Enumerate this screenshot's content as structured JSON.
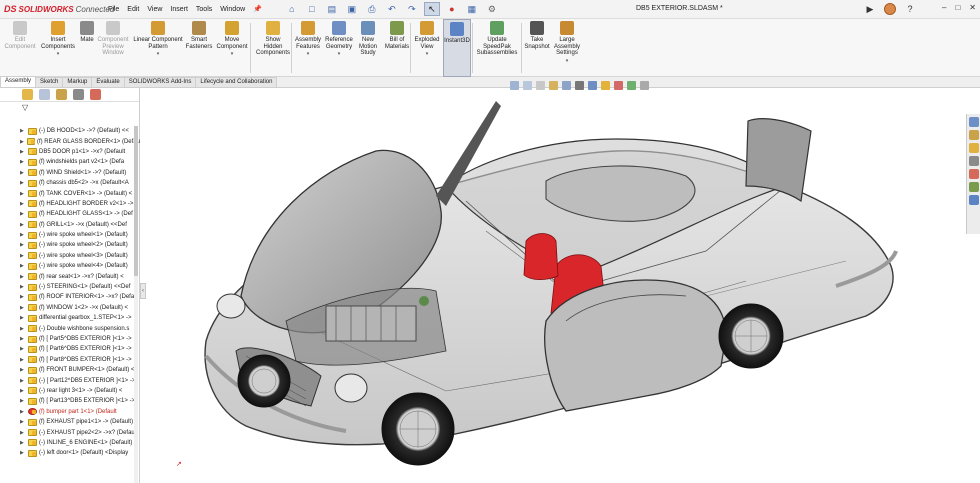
{
  "app": {
    "brand_ds": "DS",
    "brand_name": "SOLIDWORKS",
    "brand_suffix": "Connected",
    "document_title": "DB5 EXTERIOR.SLDASM *"
  },
  "menu": [
    "File",
    "Edit",
    "View",
    "Insert",
    "Tools",
    "Window"
  ],
  "ribbon": [
    {
      "label": "Edit\nComponent",
      "enabled": false,
      "icon_color": "#c9c9c9"
    },
    {
      "label": "Insert\nComponents",
      "enabled": true,
      "icon_color": "#e0a030",
      "caret": true
    },
    {
      "label": "Mate",
      "enabled": true,
      "icon_color": "#8a8a8a"
    },
    {
      "label": "Component\nPreview\nWindow",
      "enabled": false,
      "icon_color": "#c9c9c9"
    },
    {
      "label": "Linear Component\nPattern",
      "enabled": true,
      "icon_color": "#d49a34",
      "caret": true
    },
    {
      "label": "Smart\nFasteners",
      "enabled": true,
      "icon_color": "#b08a4a"
    },
    {
      "label": "Move\nComponent",
      "enabled": true,
      "icon_color": "#d4a230",
      "caret": true
    },
    {
      "label": "Show\nHidden\nComponents",
      "enabled": true,
      "icon_color": "#e0b040"
    },
    {
      "label": "Assembly\nFeatures",
      "enabled": true,
      "icon_color": "#d49a34",
      "caret": true
    },
    {
      "label": "Reference\nGeometry",
      "enabled": true,
      "icon_color": "#6f8fc4",
      "caret": true
    },
    {
      "label": "New\nMotion\nStudy",
      "enabled": true,
      "icon_color": "#6a8fb8"
    },
    {
      "label": "Bill of\nMaterials",
      "enabled": true,
      "icon_color": "#7d9a4c"
    },
    {
      "label": "Exploded\nView",
      "enabled": true,
      "icon_color": "#d49a34",
      "caret": true
    },
    {
      "label": "Instant3D",
      "enabled": true,
      "icon_color": "#5c83c4",
      "active": true
    },
    {
      "label": "Update\nSpeedPak\nSubassemblies",
      "enabled": true,
      "icon_color": "#5f9f5f"
    },
    {
      "label": "Take\nSnapshot",
      "enabled": true,
      "icon_color": "#555555"
    },
    {
      "label": "Large\nAssembly\nSettings",
      "enabled": true,
      "icon_color": "#c88a30",
      "caret": true
    }
  ],
  "tabs": [
    {
      "label": "Assembly",
      "active": true
    },
    {
      "label": "Sketch"
    },
    {
      "label": "Markup"
    },
    {
      "label": "Evaluate"
    },
    {
      "label": "SOLIDWORKS Add-Ins"
    },
    {
      "label": "Lifecycle and Collaboration"
    }
  ],
  "tree_items": [
    {
      "text": "(-) DB HOOD<1> ->? (Default) <<"
    },
    {
      "text": "(f) REAR GLASS BORDER<1> (Defau"
    },
    {
      "text": "DB5 DOOR p1<1> ->x? (Default"
    },
    {
      "text": "(f) windshields part v2<1> (Defa"
    },
    {
      "text": "(f) WIND Shield<1> ->? (Default)"
    },
    {
      "text": "(f) chassis db5<2> ->x (Default<A"
    },
    {
      "text": "(f) TANK COVER<1> -> (Default) <"
    },
    {
      "text": "(f) HEADLIGHT BORDER v2<1> ->"
    },
    {
      "text": "(f) HEADLIGHT GLASS<1> -> (Def"
    },
    {
      "text": "(f) GRILL<1> ->x (Default) <<Def"
    },
    {
      "text": "(-) wire spoke wheel<1> (Default)"
    },
    {
      "text": "(-) wire spoke wheel<2> (Default)"
    },
    {
      "text": "(-) wire spoke wheel<3> (Default)"
    },
    {
      "text": "(-) wire spoke wheel<4> (Default)"
    },
    {
      "text": "(f) rear seat<1> ->x? (Default) <"
    },
    {
      "text": "(-) STEERING<1> (Default) <<Def"
    },
    {
      "text": "(f) ROOF INTERIOR<1> ->x? (Defa"
    },
    {
      "text": "(f) WINDOW 1<2> ->x (Default) <"
    },
    {
      "text": "differential gearbox_1.STEP<1> ->"
    },
    {
      "text": "(-) Double wishbone suspension.s"
    },
    {
      "text": "(f) [ Part5^DB5 EXTERIOR ]<1> ->"
    },
    {
      "text": "(f) [ Part6^DB5 EXTERIOR ]<1> ->"
    },
    {
      "text": "(f) [ Part8^DB5 EXTERIOR ]<1> ->"
    },
    {
      "text": "(f) FRONT BUMPER<1> (Default) <"
    },
    {
      "text": "(-) [ Part12^DB5 EXTERIOR ]<1> ->"
    },
    {
      "text": "(-) rear light 3<1> -> (Default) <"
    },
    {
      "text": "(f) [ Part13^DB5 EXTERIOR ]<1> ->"
    },
    {
      "text": "(f) bumper part 1<1> (Default",
      "error": true
    },
    {
      "text": "(f) EXHAUST pipe1<1> -> (Default)"
    },
    {
      "text": "(-) EXHAUST pipe2<2> ->x? (Defau"
    },
    {
      "text": "(-) INLINE_6 ENGINE<1> (Default)"
    },
    {
      "text": "(-) left door<1> (Default) <Display"
    }
  ],
  "colors": {
    "accent": "#3b63a8",
    "brand_red": "#d4202c",
    "error_red": "#c0281c",
    "seat_red": "#d8262a",
    "body_gray": "#b9b9b9"
  }
}
